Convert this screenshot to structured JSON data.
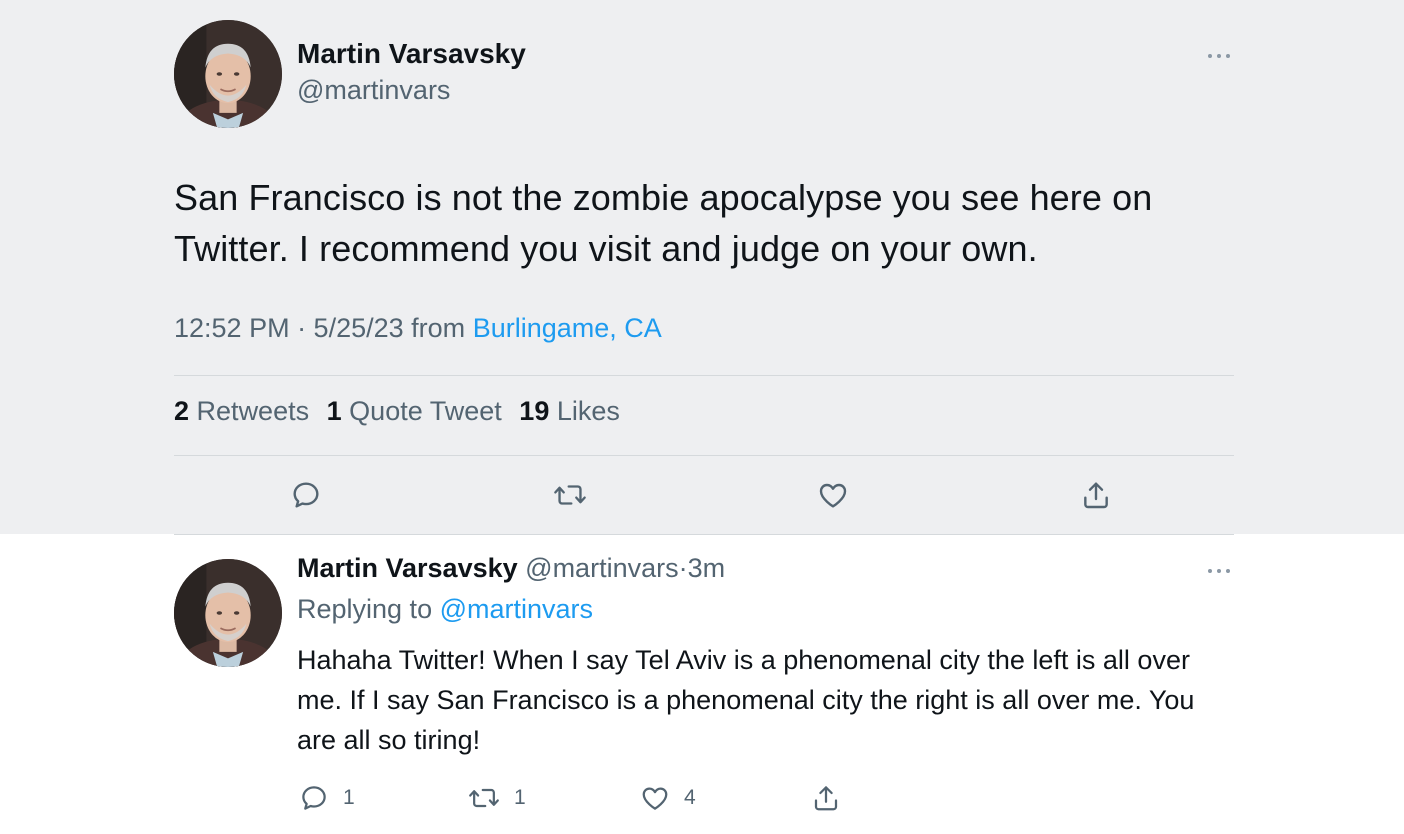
{
  "main_tweet": {
    "author_name": "Martin Varsavsky",
    "author_handle": "@martinvars",
    "text": "San Francisco is not the zombie apocalypse you see here on Twitter. I recommend you visit and judge on your own.",
    "time": "12:52 PM · 5/25/23",
    "from_label": "from",
    "location": "Burlingame, CA",
    "stats": {
      "retweets_count": "2",
      "retweets_label": "Retweets",
      "quotes_count": "1",
      "quotes_label": "Quote Tweet",
      "likes_count": "19",
      "likes_label": "Likes"
    },
    "actions": [
      "reply-icon",
      "retweet-icon",
      "like-icon",
      "share-icon"
    ]
  },
  "reply_tweet": {
    "author_name": "Martin Varsavsky",
    "author_handle": "@martinvars",
    "separator": "·",
    "age": "3m",
    "replying_label": "Replying to",
    "replying_to": "@martinvars",
    "text": "Hahaha Twitter! When I say Tel Aviv is a phenomenal city the left is all over me. If I say San Francisco is a phenomenal city the right is all over me. You are all so tiring!",
    "counts": {
      "replies": "1",
      "retweets": "1",
      "likes": "4"
    }
  },
  "colors": {
    "accent": "#1d9bf0",
    "text_primary": "#0f1419",
    "text_secondary": "#536471",
    "highlight_background": "#eeeff1"
  }
}
